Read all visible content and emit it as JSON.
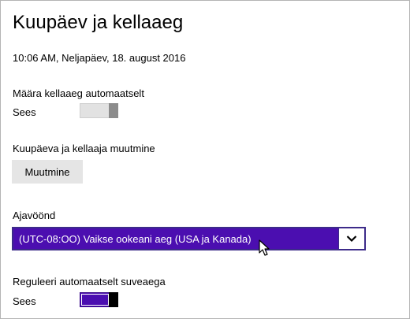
{
  "page": {
    "title": "Kuupäev ja kellaaeg",
    "current_datetime": "10:06 AM, Neljapäev, 18. august 2016"
  },
  "auto_time": {
    "label": "Määra kellaaeg automaatselt",
    "state": "Sees",
    "on": true
  },
  "change_datetime": {
    "label": "Kuupäeva ja kellaaja muutmine",
    "button_label": "Muutmine"
  },
  "timezone": {
    "label": "Ajavöönd",
    "selected": "(UTC-08:OO) Vaikse ookeani aeg (USA ja Kanada)"
  },
  "auto_dst": {
    "label": "Reguleeri automaatselt suveaega",
    "state": "Sees",
    "on": true
  },
  "colors": {
    "accent": "#4b0eb0",
    "toggle_off_track": "#e2e2e2",
    "button_bg": "#e5e5e5"
  },
  "icons": {
    "dropdown": "chevron-down-icon",
    "pointer": "mouse-cursor-icon"
  }
}
